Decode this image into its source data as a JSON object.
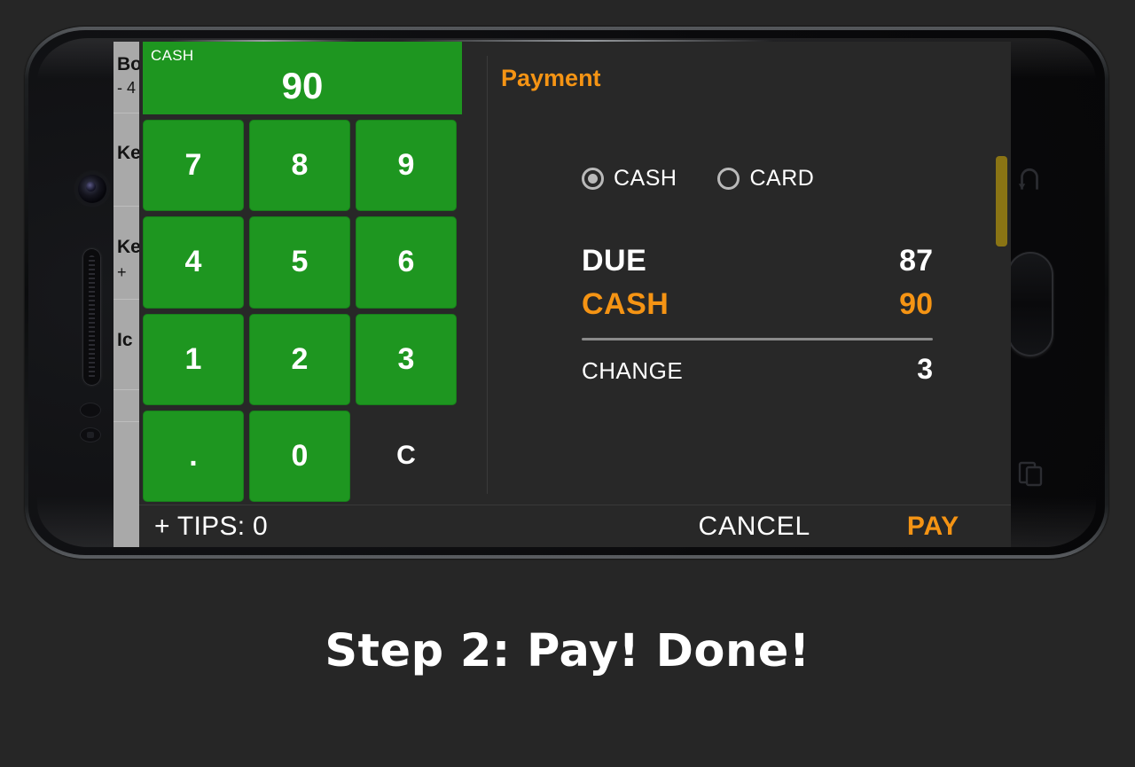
{
  "caption": "Step 2: Pay! Done!",
  "colors": {
    "accent_orange": "#f59414",
    "keypad_green": "#1e9620",
    "panel_dark": "#282828",
    "page_bg": "#262626",
    "scrollbar": "#8a7414"
  },
  "background_list": {
    "rows": [
      {
        "title": "Bo",
        "sub": "- 4"
      },
      {
        "title": "Ke",
        "sub": ""
      },
      {
        "title": "Ke",
        "sub": "+"
      },
      {
        "title": "Ic",
        "sub": ""
      }
    ]
  },
  "keypad": {
    "display_label": "CASH",
    "display_value": "90",
    "keys": [
      "7",
      "8",
      "9",
      "4",
      "5",
      "6",
      "1",
      "2",
      "3",
      ".",
      "0",
      "C"
    ]
  },
  "payment": {
    "title": "Payment",
    "methods": [
      {
        "label": "CASH",
        "selected": true
      },
      {
        "label": "CARD",
        "selected": false
      }
    ],
    "totals": [
      {
        "label": "DUE",
        "value": "87"
      },
      {
        "label": "CASH",
        "value": "90"
      },
      {
        "label": "CHANGE",
        "value": "3"
      }
    ]
  },
  "action_bar": {
    "tips": "+ TIPS: 0",
    "cancel": "CANCEL",
    "pay": "PAY"
  },
  "device": {
    "nav_back_icon": "back-arrow-icon",
    "nav_home_icon": "home-button",
    "nav_recent_icon": "recents-icon",
    "camera_icon": "front-camera",
    "speaker_icon": "earpiece-speaker"
  }
}
